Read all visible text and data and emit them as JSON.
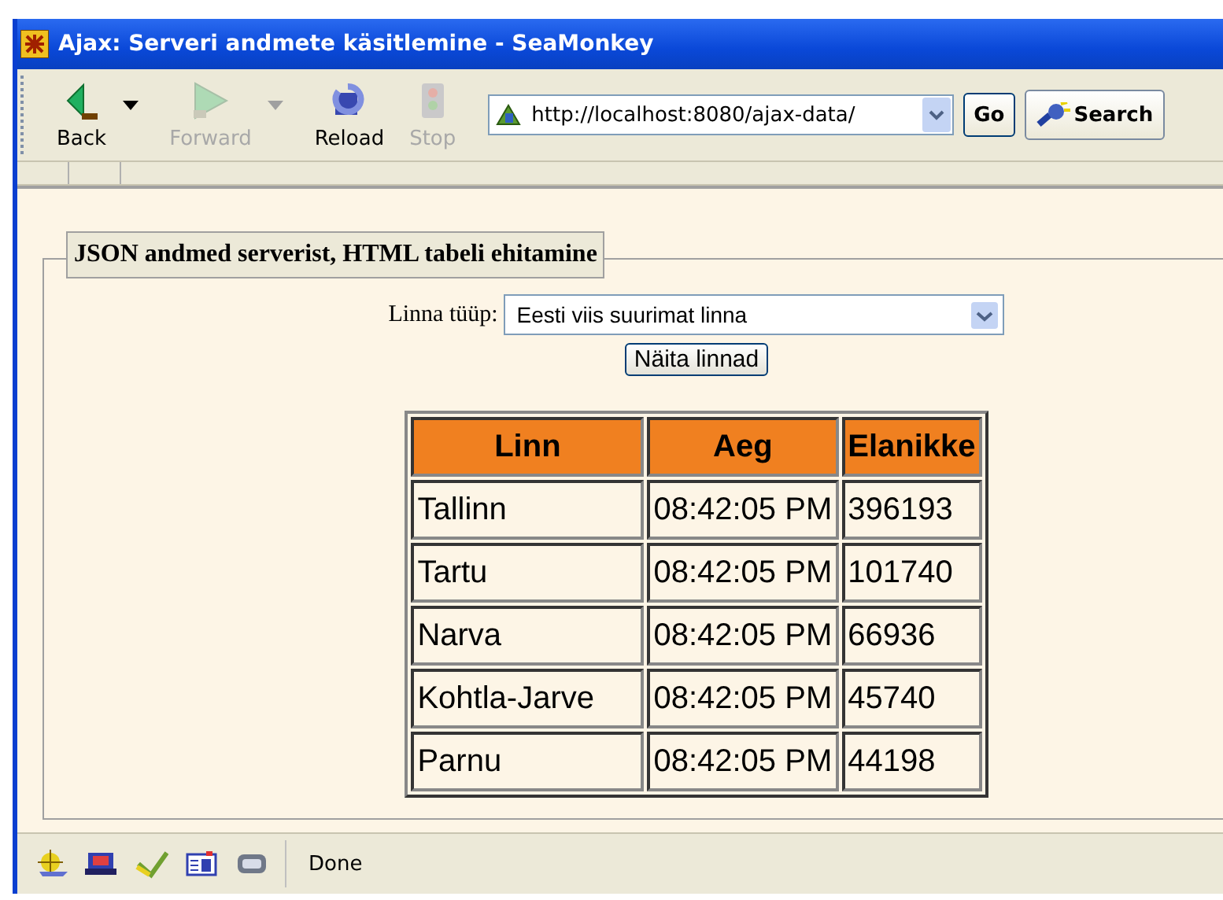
{
  "window": {
    "title": "Ajax: Serveri andmete käsitlemine - SeaMonkey"
  },
  "toolbar": {
    "buttons": [
      {
        "label": "Back",
        "kind": "back",
        "disabled": false,
        "menu": true
      },
      {
        "label": "Forward",
        "kind": "forward",
        "disabled": true,
        "menu": true
      },
      {
        "label": "Reload",
        "kind": "reload",
        "disabled": false,
        "menu": false
      },
      {
        "label": "Stop",
        "kind": "stop",
        "disabled": true,
        "menu": false
      }
    ],
    "address": "http://localhost:8080/ajax-data/",
    "go": "Go",
    "search": "Search"
  },
  "page": {
    "legend": "JSON andmed serverist, HTML tabeli ehitamine",
    "select_label": "Linna tüüp:",
    "select_value": "Eesti viis suurimat linna",
    "button": "Näita linnad",
    "table": {
      "columns": [
        "Linn",
        "Aeg",
        "Elanikke"
      ],
      "rows": [
        [
          "Tallinn",
          "08:42:05 PM",
          "396193"
        ],
        [
          "Tartu",
          "08:42:05 PM",
          "101740"
        ],
        [
          "Narva",
          "08:42:05 PM",
          "66936"
        ],
        [
          "Kohtla-Jarve",
          "08:42:05 PM",
          "45740"
        ],
        [
          "Parnu",
          "08:42:05 PM",
          "44198"
        ]
      ]
    }
  },
  "status_bar": {
    "text": "Done"
  }
}
